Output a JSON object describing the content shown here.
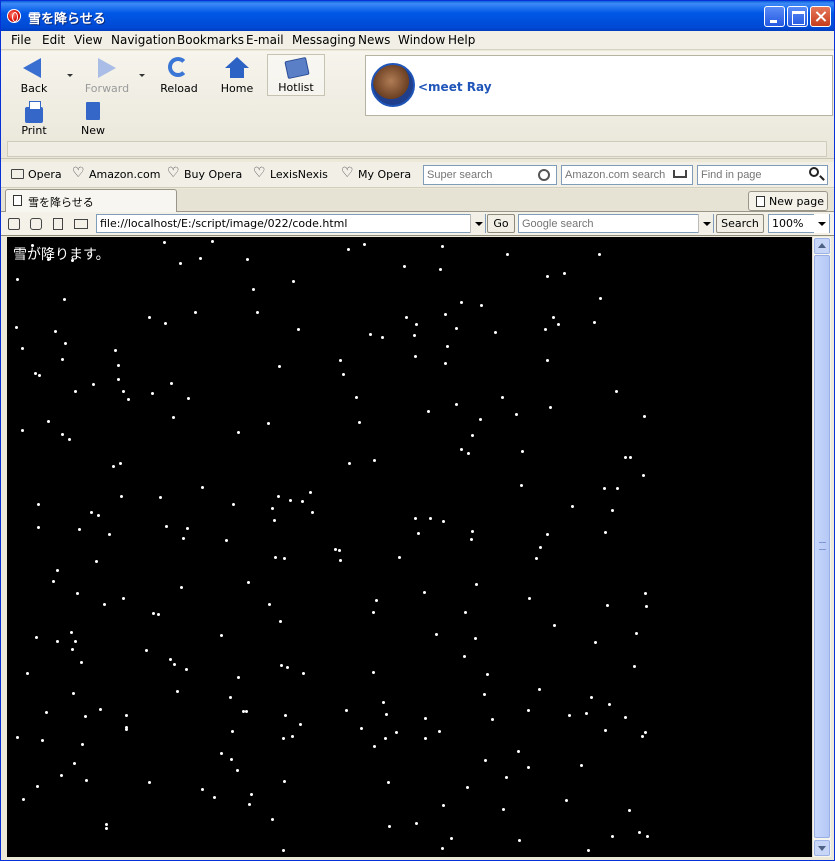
{
  "window": {
    "title": "雪を降らせる"
  },
  "menu": [
    "File",
    "Edit",
    "View",
    "Navigation",
    "Bookmarks",
    "E-mail",
    "Messaging",
    "News",
    "Window",
    "Help"
  ],
  "toolbar": {
    "back": "Back",
    "forward": "Forward",
    "reload": "Reload",
    "home": "Home",
    "hotlist": "Hotlist",
    "print": "Print",
    "new": "New"
  },
  "ad": {
    "text": "<meet Ray"
  },
  "personal_bar": {
    "items": [
      "Opera",
      "Amazon.com",
      "Buy Opera",
      "LexisNexis",
      "My Opera"
    ],
    "super_search_placeholder": "Super search",
    "amazon_search_placeholder": "Amazon.com search",
    "find_in_page_placeholder": "Find in page"
  },
  "tabs": {
    "active": "雪を降らせる",
    "new_page": "New page"
  },
  "address_bar": {
    "url": "file://localhost/E:/script/image/022/code.html",
    "go": "Go",
    "google_search_placeholder": "Google search",
    "search": "Search",
    "zoom": "100%"
  },
  "content": {
    "message": "雪が降ります。"
  }
}
